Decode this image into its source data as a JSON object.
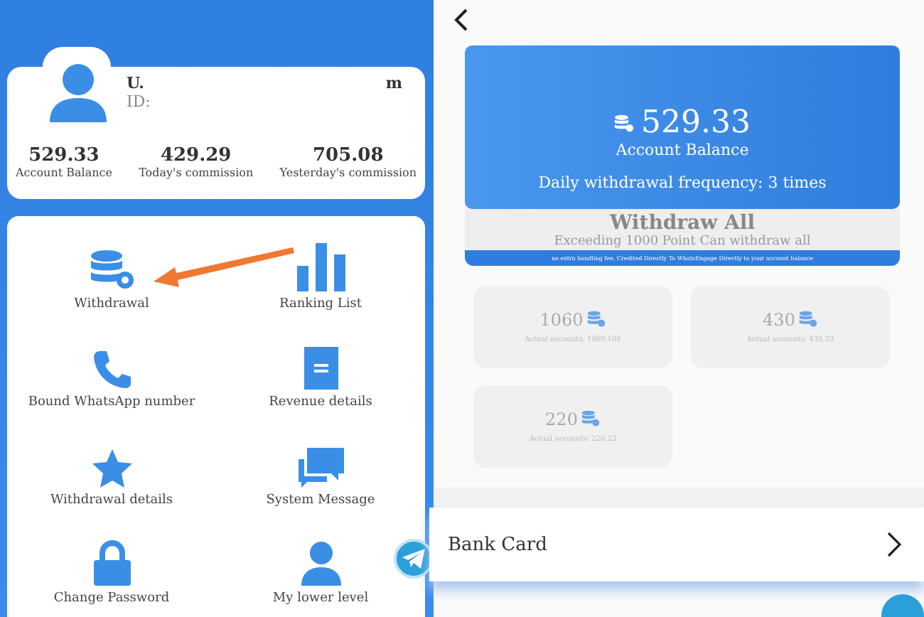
{
  "profile": {
    "name_start": "U.",
    "name_end": "m",
    "id_label": "ID:"
  },
  "stats": [
    {
      "value": "529.33",
      "label": "Account Balance"
    },
    {
      "value": "429.29",
      "label": "Today's commission"
    },
    {
      "value": "705.08",
      "label": "Yesterday's commission"
    }
  ],
  "menu": [
    {
      "kind": "database",
      "label": "Withdrawal"
    },
    {
      "kind": "chart",
      "label": "Ranking List"
    },
    {
      "kind": "phone",
      "label": "Bound WhatsApp number"
    },
    {
      "kind": "document",
      "label": "Revenue details"
    },
    {
      "kind": "star",
      "label": "Withdrawal details"
    },
    {
      "kind": "chat",
      "label": "System Message"
    },
    {
      "kind": "lock",
      "label": "Change Password"
    },
    {
      "kind": "person",
      "label": "My lower level"
    }
  ],
  "withdraw_page": {
    "balance": "529.33",
    "balance_label": "Account Balance",
    "frequency": "Daily withdrawal frequency: 3 times",
    "withdraw_all": "Withdraw All",
    "withdraw_all_note": "Exceeding 1000 Point Can withdraw all",
    "fee_note": "no extra handling fee, Credited Directly To WhatsEngage Directly to your account balance",
    "amounts": [
      {
        "value": "1060",
        "actual": "Actual accounts: 1060.108"
      },
      {
        "value": "430",
        "actual": "Actual accounts: 430.33"
      },
      {
        "value": "220",
        "actual": "Actual accounts: 220.23"
      }
    ],
    "bank_card": "Bank Card"
  }
}
